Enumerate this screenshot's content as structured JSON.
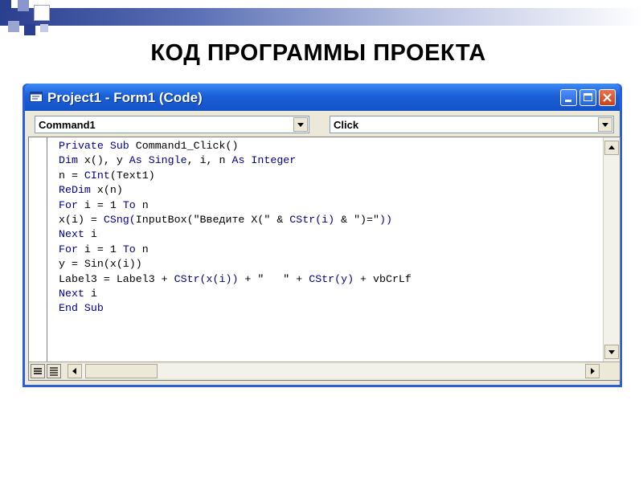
{
  "slide": {
    "title": "КОД ПРОГРАММЫ ПРОЕКТА"
  },
  "window": {
    "title": "Project1 - Form1 (Code)"
  },
  "editor": {
    "object_combo": "Command1",
    "procedure_combo": "Click",
    "code_lines": [
      [
        {
          "k": true,
          "t": "Private Sub "
        },
        {
          "k": false,
          "t": "Command1_Click()"
        }
      ],
      [
        {
          "k": true,
          "t": "Dim "
        },
        {
          "k": false,
          "t": "x(), y "
        },
        {
          "k": true,
          "t": "As Single"
        },
        {
          "k": false,
          "t": ", i, n "
        },
        {
          "k": true,
          "t": "As Integer"
        }
      ],
      [
        {
          "k": false,
          "t": "n = "
        },
        {
          "k": true,
          "t": "CInt"
        },
        {
          "k": false,
          "t": "(Text1)"
        }
      ],
      [
        {
          "k": true,
          "t": "ReDim "
        },
        {
          "k": false,
          "t": "x(n)"
        }
      ],
      [
        {
          "k": true,
          "t": "For "
        },
        {
          "k": false,
          "t": "i = 1 "
        },
        {
          "k": true,
          "t": "To "
        },
        {
          "k": false,
          "t": "n"
        }
      ],
      [
        {
          "k": false,
          "t": "x(i) = "
        },
        {
          "k": true,
          "t": "CSng("
        },
        {
          "k": false,
          "t": "InputBox(\"Введите X(\" & "
        },
        {
          "k": true,
          "t": "CStr(i)"
        },
        {
          "k": false,
          "t": " & \")=\""
        },
        {
          "k": true,
          "t": "))"
        }
      ],
      [
        {
          "k": true,
          "t": "Next "
        },
        {
          "k": false,
          "t": "i"
        }
      ],
      [
        {
          "k": true,
          "t": "For "
        },
        {
          "k": false,
          "t": "i = 1 "
        },
        {
          "k": true,
          "t": "To "
        },
        {
          "k": false,
          "t": "n"
        }
      ],
      [
        {
          "k": false,
          "t": "y = Sin(x(i))"
        }
      ],
      [
        {
          "k": false,
          "t": "Label3 = Label3 + "
        },
        {
          "k": true,
          "t": "CStr(x(i))"
        },
        {
          "k": false,
          "t": " + \"   \" + "
        },
        {
          "k": true,
          "t": "CStr(y)"
        },
        {
          "k": false,
          "t": " + vbCrLf"
        }
      ],
      [
        {
          "k": true,
          "t": "Next "
        },
        {
          "k": false,
          "t": "i"
        }
      ],
      [
        {
          "k": true,
          "t": "End Sub"
        }
      ]
    ]
  },
  "icons": {
    "app": "form-code-icon",
    "minimize": "minimize-icon",
    "maximize": "maximize-icon",
    "close": "close-icon",
    "dropdown": "chevron-down-icon",
    "scroll_up": "arrow-up-icon",
    "scroll_down": "arrow-down-icon",
    "scroll_left": "arrow-left-icon",
    "scroll_right": "arrow-right-icon",
    "procedure_view": "procedure-view-icon",
    "full_module_view": "full-module-view-icon"
  },
  "colors": {
    "keyword": "#00008b",
    "titlebar": "#1a5fd8",
    "window_frame": "#2c5fd6"
  }
}
